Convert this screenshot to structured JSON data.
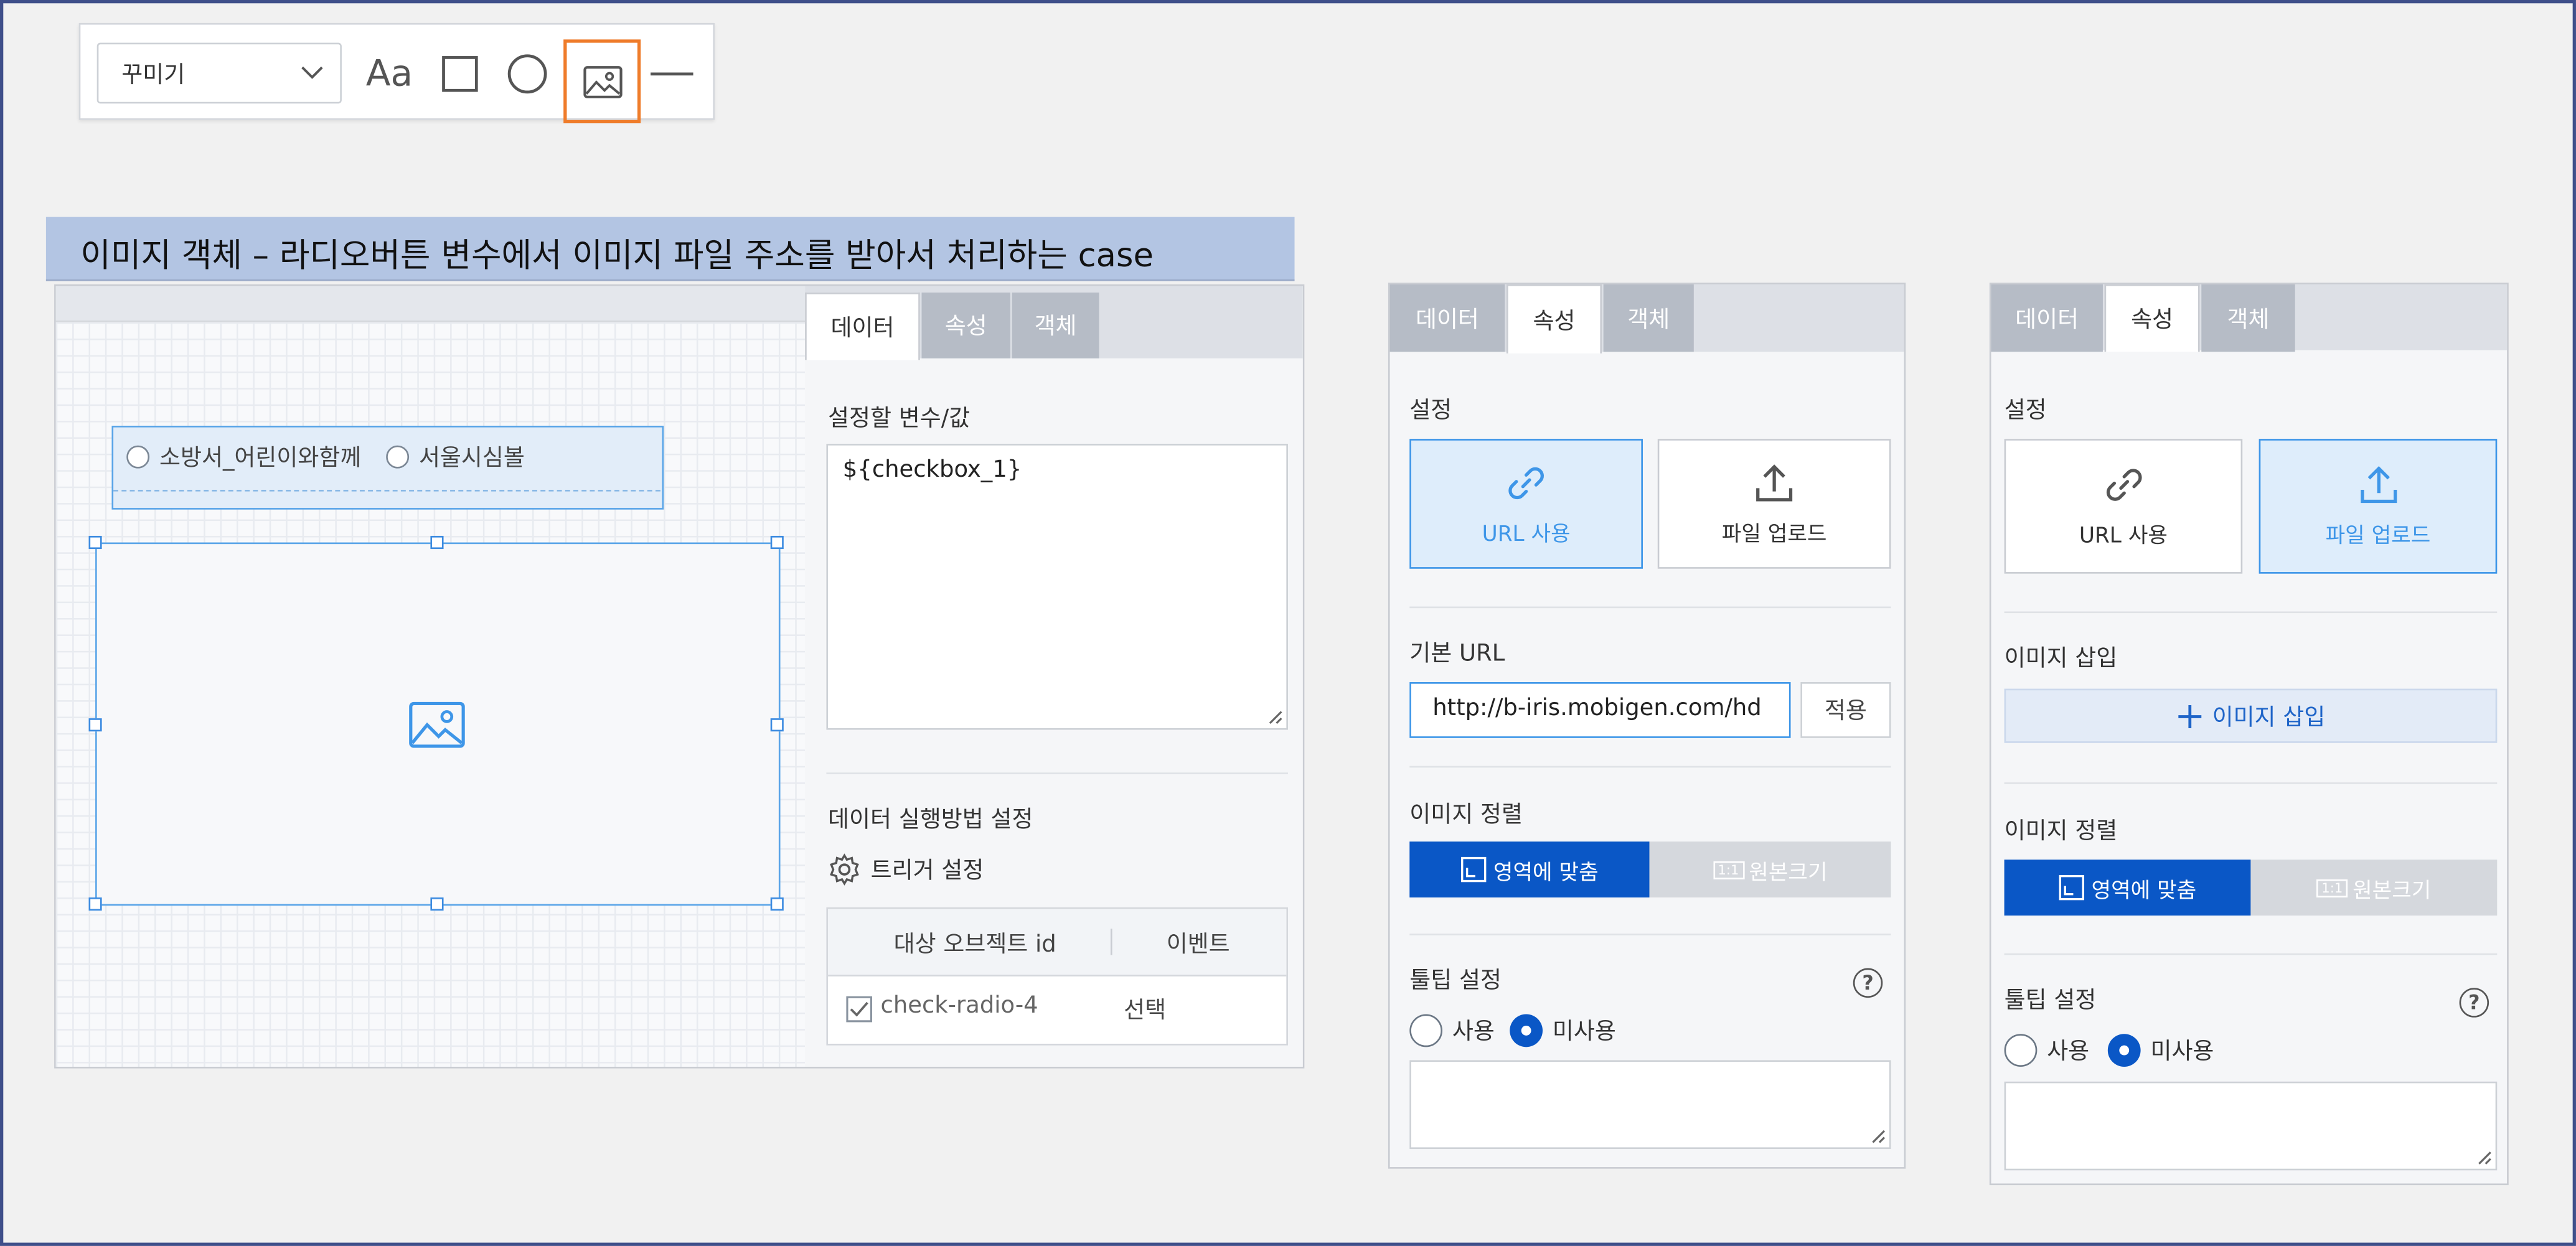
{
  "toolbar": {
    "dropdown_label": "꾸미기",
    "text_tool": "Aa",
    "tools": [
      "text-icon",
      "rectangle-icon",
      "circle-icon",
      "image-icon",
      "line-icon"
    ],
    "selected_tool": "image-icon"
  },
  "banner": {
    "text": "이미지 객체 – 라디오버튼 변수에서 이미지 파일 주소를 받아서 처리하는 case"
  },
  "canvas": {
    "radio_options": [
      "소방서_어린이와함께",
      "서울시심볼"
    ]
  },
  "panel1": {
    "tabs": [
      "데이터",
      "속성",
      "객체"
    ],
    "active_tab": "데이터",
    "var_label": "설정할 변수/값",
    "var_value": "${checkbox_1}",
    "exec_label": "데이터 실행방법 설정",
    "trigger_label": "트리거 설정",
    "table": {
      "headers": [
        "대상 오브젝트 id",
        "이벤트"
      ],
      "rows": [
        {
          "id": "check-radio-4",
          "event": "선택",
          "checked": true
        }
      ]
    }
  },
  "panel2": {
    "tabs": [
      "데이터",
      "속성",
      "객체"
    ],
    "active_tab": "속성",
    "settings_label": "설정",
    "card_url": "URL 사용",
    "card_upload": "파일 업로드",
    "selected_card": "URL 사용",
    "base_url_label": "기본 URL",
    "base_url_value": "http://b-iris.mobigen.com/hd",
    "apply_label": "적용",
    "align_label": "이미지 정렬",
    "align_fit": "영역에 맞춤",
    "align_orig": "원본크기",
    "align_orig_icon": "1:1",
    "tooltip_label": "툴팁 설정",
    "help": "?",
    "radio_use": "사용",
    "radio_nouse": "미사용",
    "tooltip_selected": "미사용"
  },
  "panel3": {
    "tabs": [
      "데이터",
      "속성",
      "객체"
    ],
    "active_tab": "속성",
    "settings_label": "설정",
    "card_url": "URL 사용",
    "card_upload": "파일 업로드",
    "selected_card": "파일 업로드",
    "insert_label": "이미지 삽입",
    "insert_btn": "이미지 삽입",
    "align_label": "이미지 정렬",
    "align_fit": "영역에 맞춤",
    "align_orig": "원본크기",
    "align_orig_icon": "1:1",
    "tooltip_label": "툴팁 설정",
    "help": "?",
    "radio_use": "사용",
    "radio_nouse": "미사용",
    "tooltip_selected": "미사용"
  },
  "colors": {
    "accent": "#0a57c6",
    "selection": "#3e96e8",
    "tool_selected": "#ef7c2a",
    "banner": "#b3c5e3"
  }
}
